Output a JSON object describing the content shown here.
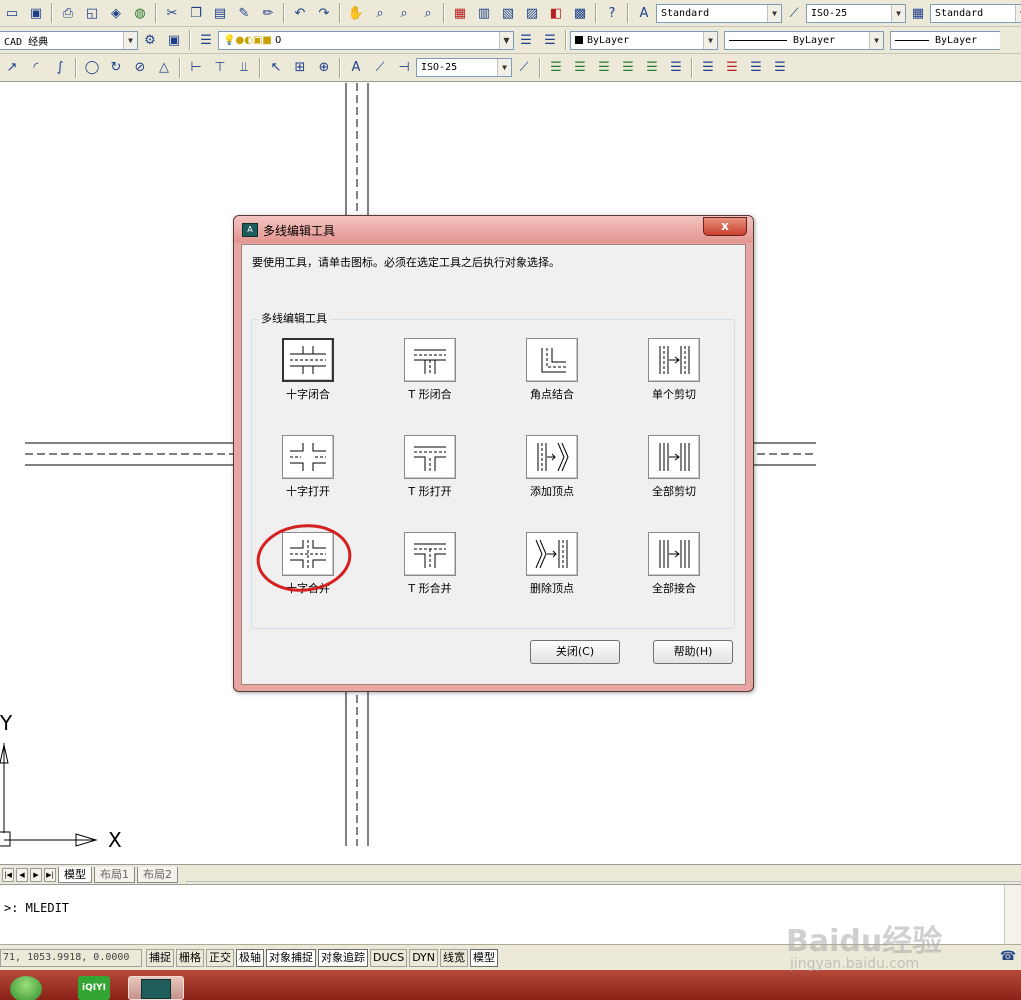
{
  "toolbar1": {
    "text_style": "Standard",
    "dim_style": "ISO-25",
    "table_style": "Standard"
  },
  "toolbar2": {
    "workspace": "CAD 经典",
    "layer": "0",
    "color": "ByLayer",
    "linetype": "ByLayer",
    "lineweight": "ByLayer"
  },
  "toolbar3": {
    "dim_style": "ISO-25"
  },
  "dialog": {
    "icon_text": "A",
    "title": "多线编辑工具",
    "close_glyph": "x",
    "instruction": "要使用工具，请单击图标。必须在选定工具之后执行对象选择。",
    "group_label": "多线编辑工具",
    "tools": [
      {
        "label": "十字闭合",
        "icon": "closed-cross-icon"
      },
      {
        "label": "T 形闭合",
        "icon": "closed-tee-icon"
      },
      {
        "label": "角点结合",
        "icon": "corner-joint-icon"
      },
      {
        "label": "单个剪切",
        "icon": "cut-single-icon"
      },
      {
        "label": "十字打开",
        "icon": "open-cross-icon"
      },
      {
        "label": "T 形打开",
        "icon": "open-tee-icon"
      },
      {
        "label": "添加顶点",
        "icon": "add-vertex-icon"
      },
      {
        "label": "全部剪切",
        "icon": "cut-all-icon"
      },
      {
        "label": "十字合并",
        "icon": "merged-cross-icon"
      },
      {
        "label": "T 形合并",
        "icon": "merged-tee-icon"
      },
      {
        "label": "删除顶点",
        "icon": "delete-vertex-icon"
      },
      {
        "label": "全部接合",
        "icon": "weld-all-icon"
      }
    ],
    "close_button": "关闭(C)",
    "help_button": "帮助(H)"
  },
  "canvas": {
    "ucs_y": "Y",
    "ucs_x": "X"
  },
  "layout_tabs": [
    "模型",
    "布局1",
    "布局2"
  ],
  "command_line": ">: MLEDIT",
  "status": {
    "coords": "71, 1053.9918, 0.0000",
    "toggles": [
      {
        "label": "捕捉",
        "on": false
      },
      {
        "label": "栅格",
        "on": false
      },
      {
        "label": "正交",
        "on": false
      },
      {
        "label": "极轴",
        "on": true
      },
      {
        "label": "对象捕捉",
        "on": true
      },
      {
        "label": "对象追踪",
        "on": true
      },
      {
        "label": "DUCS",
        "on": false
      },
      {
        "label": "DYN",
        "on": false
      },
      {
        "label": "线宽",
        "on": false
      },
      {
        "label": "模型",
        "on": true
      }
    ]
  },
  "taskbar": {
    "app2_label": "iQIYI"
  },
  "watermark": {
    "brand": "Baidu经验",
    "url": "jingyan.baidu.com"
  },
  "colors": {
    "annotation_circle": "#d42020",
    "taskbar": "#9b2f22",
    "dialog_frame": "#e7a6a2"
  }
}
